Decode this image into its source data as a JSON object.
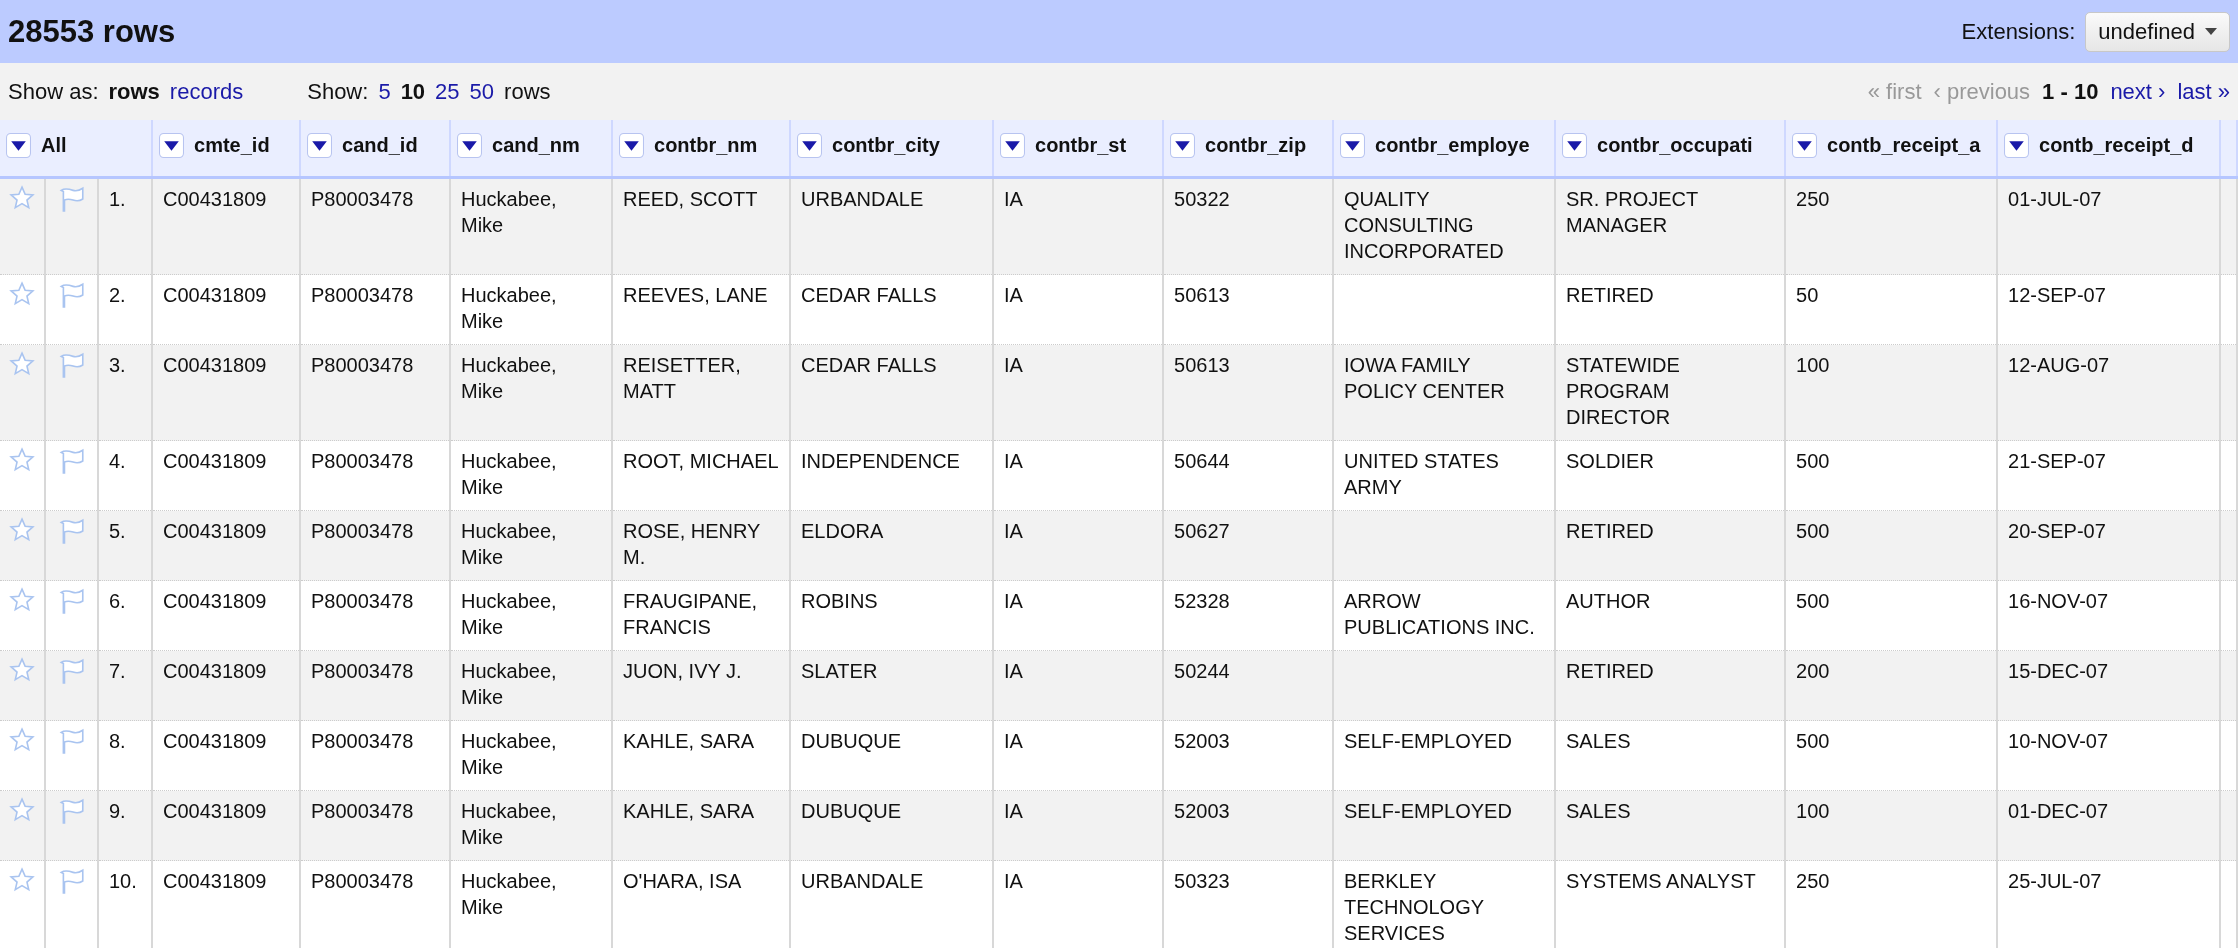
{
  "title": "28553 rows",
  "extensions": {
    "label": "Extensions:",
    "value": "undefined"
  },
  "show_as": {
    "label": "Show as:",
    "options": [
      {
        "label": "rows",
        "selected": true
      },
      {
        "label": "records",
        "selected": false
      }
    ]
  },
  "show": {
    "label": "Show:",
    "options": [
      {
        "label": "5",
        "selected": false
      },
      {
        "label": "10",
        "selected": true
      },
      {
        "label": "25",
        "selected": false
      },
      {
        "label": "50",
        "selected": false
      }
    ],
    "suffix": "rows"
  },
  "pager": {
    "first": {
      "label": "« first",
      "disabled": true
    },
    "previous": {
      "label": "‹ previous",
      "disabled": true
    },
    "range": "1 - 10",
    "next": {
      "label": "next ›",
      "disabled": false
    },
    "last": {
      "label": "last »",
      "disabled": false
    }
  },
  "all_label": "All",
  "columns": [
    "cmte_id",
    "cand_id",
    "cand_nm",
    "contbr_nm",
    "contbr_city",
    "contbr_st",
    "contbr_zip",
    "contbr_employe",
    "contbr_occupati",
    "contb_receipt_a",
    "contb_receipt_d"
  ],
  "rows": [
    {
      "starred": false,
      "flagged": false,
      "index": "1.",
      "cells": [
        "C00431809",
        "P80003478",
        "Huckabee, Mike",
        "REED, SCOTT",
        "URBANDALE",
        "IA",
        "50322",
        "QUALITY CONSULTING INCORPORATED",
        "SR. PROJECT MANAGER",
        "250",
        "01-JUL-07"
      ]
    },
    {
      "starred": false,
      "flagged": false,
      "index": "2.",
      "cells": [
        "C00431809",
        "P80003478",
        "Huckabee, Mike",
        "REEVES, LANE",
        "CEDAR FALLS",
        "IA",
        "50613",
        "",
        "RETIRED",
        "50",
        "12-SEP-07"
      ]
    },
    {
      "starred": false,
      "flagged": false,
      "index": "3.",
      "cells": [
        "C00431809",
        "P80003478",
        "Huckabee, Mike",
        "REISETTER, MATT",
        "CEDAR FALLS",
        "IA",
        "50613",
        "IOWA FAMILY POLICY CENTER",
        "STATEWIDE PROGRAM DIRECTOR",
        "100",
        "12-AUG-07"
      ]
    },
    {
      "starred": false,
      "flagged": false,
      "index": "4.",
      "cells": [
        "C00431809",
        "P80003478",
        "Huckabee, Mike",
        "ROOT, MICHAEL",
        "INDEPENDENCE",
        "IA",
        "50644",
        "UNITED STATES ARMY",
        "SOLDIER",
        "500",
        "21-SEP-07"
      ]
    },
    {
      "starred": false,
      "flagged": false,
      "index": "5.",
      "cells": [
        "C00431809",
        "P80003478",
        "Huckabee, Mike",
        "ROSE, HENRY M.",
        "ELDORA",
        "IA",
        "50627",
        "",
        "RETIRED",
        "500",
        "20-SEP-07"
      ]
    },
    {
      "starred": false,
      "flagged": false,
      "index": "6.",
      "cells": [
        "C00431809",
        "P80003478",
        "Huckabee, Mike",
        "FRAUGIPANE, FRANCIS",
        "ROBINS",
        "IA",
        "52328",
        "ARROW PUBLICATIONS INC.",
        "AUTHOR",
        "500",
        "16-NOV-07"
      ]
    },
    {
      "starred": false,
      "flagged": false,
      "index": "7.",
      "cells": [
        "C00431809",
        "P80003478",
        "Huckabee, Mike",
        "JUON, IVY J.",
        "SLATER",
        "IA",
        "50244",
        "",
        "RETIRED",
        "200",
        "15-DEC-07"
      ]
    },
    {
      "starred": false,
      "flagged": false,
      "index": "8.",
      "cells": [
        "C00431809",
        "P80003478",
        "Huckabee, Mike",
        "KAHLE, SARA",
        "DUBUQUE",
        "IA",
        "52003",
        "SELF-EMPLOYED",
        "SALES",
        "500",
        "10-NOV-07"
      ]
    },
    {
      "starred": false,
      "flagged": false,
      "index": "9.",
      "cells": [
        "C00431809",
        "P80003478",
        "Huckabee, Mike",
        "KAHLE, SARA",
        "DUBUQUE",
        "IA",
        "52003",
        "SELF-EMPLOYED",
        "SALES",
        "100",
        "01-DEC-07"
      ]
    },
    {
      "starred": false,
      "flagged": false,
      "index": "10.",
      "cells": [
        "C00431809",
        "P80003478",
        "Huckabee, Mike",
        "O'HARA, ISA",
        "URBANDALE",
        "IA",
        "50323",
        "BERKLEY TECHNOLOGY SERVICES",
        "SYSTEMS ANALYST",
        "250",
        "25-JUL-07"
      ]
    }
  ]
}
